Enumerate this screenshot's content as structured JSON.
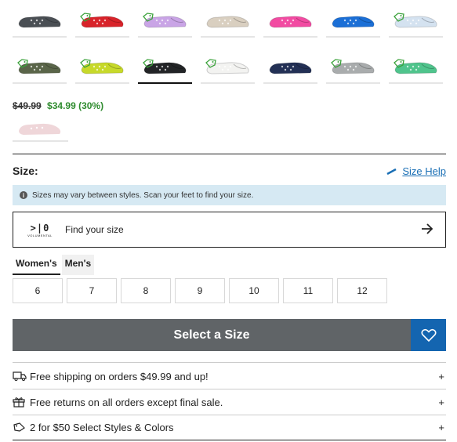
{
  "swatches": {
    "row1": [
      {
        "color": "#4a4f54",
        "tag": false
      },
      {
        "color": "#d8232a",
        "tag": true
      },
      {
        "color": "#c9a4e6",
        "tag": true
      },
      {
        "color": "#d9cfc0",
        "tag": false
      },
      {
        "color": "#f24ba2",
        "tag": false
      },
      {
        "color": "#1b6fd6",
        "tag": false
      },
      {
        "color": "#d4e2f0",
        "tag": true
      }
    ],
    "row2": [
      {
        "color": "#5a6549",
        "tag": true
      },
      {
        "color": "#c7d92a",
        "tag": true
      },
      {
        "color": "#222426",
        "tag": true,
        "selected": true
      },
      {
        "color": "#f3f3f1",
        "tag": true
      },
      {
        "color": "#233055",
        "tag": false
      },
      {
        "color": "#a9acad",
        "tag": true
      },
      {
        "color": "#4fc48c",
        "tag": true
      }
    ],
    "tag_color": "#3aa13a"
  },
  "price": {
    "original": "$49.99",
    "sale": "$34.99 (30%)"
  },
  "extra_swatch": {
    "color": "#efd6d9"
  },
  "size": {
    "label": "Size:",
    "help": "Size Help",
    "notice": "Sizes may vary between styles. Scan your feet to find your size.",
    "find_label": "Find your size",
    "logo_mark": ">|0",
    "logo_word": "VOLUMENTAL",
    "tabs": [
      "Women's",
      "Men's"
    ],
    "options": [
      "6",
      "7",
      "8",
      "9",
      "10",
      "11",
      "12"
    ]
  },
  "cta": {
    "label": "Select a Size"
  },
  "info": [
    {
      "text": "Free shipping on orders $49.99 and up!",
      "icon": "truck-icon"
    },
    {
      "text": "Free returns on all orders except final sale.",
      "icon": "gift-icon"
    },
    {
      "text": "2 for $50 Select Styles & Colors",
      "icon": "tag-icon"
    }
  ],
  "colors": {
    "cta_bg": "#606467",
    "fav_bg": "#1465b0",
    "sale_green": "#2e8b2e",
    "notice_bg": "#d6e9f3"
  }
}
